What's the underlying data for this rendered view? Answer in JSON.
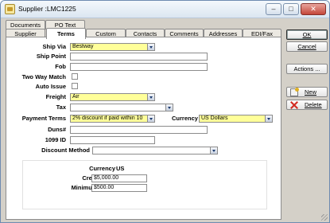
{
  "window": {
    "title": "Supplier :LMC1225",
    "minimize_icon": "minimize-icon",
    "maximize_icon": "maximize-icon",
    "close_icon": "close-icon"
  },
  "tabs_top": [
    {
      "label": "Documents"
    },
    {
      "label": "PO Text"
    }
  ],
  "tabs_main": [
    {
      "label": "Supplier"
    },
    {
      "label": "Terms",
      "active": true
    },
    {
      "label": "Custom"
    },
    {
      "label": "Contacts"
    },
    {
      "label": "Comments"
    },
    {
      "label": "Addresses"
    },
    {
      "label": "EDI/Fax"
    }
  ],
  "form": {
    "ship_via": {
      "label": "Ship Via",
      "value": "Bestway"
    },
    "ship_point": {
      "label": "Ship Point",
      "value": ""
    },
    "fob": {
      "label": "Fob",
      "value": ""
    },
    "two_way_match": {
      "label": "Two Way Match",
      "checked": false
    },
    "auto_issue": {
      "label": "Auto Issue",
      "checked": false
    },
    "freight": {
      "label": "Freight",
      "value": "Air"
    },
    "tax": {
      "label": "Tax",
      "value": ""
    },
    "payment_terms": {
      "label": "Payment Terms",
      "value": "2% discount if paid within 10"
    },
    "currency": {
      "label": "Currency",
      "value": "US Dollars"
    },
    "duns": {
      "label": "Duns#",
      "value": ""
    },
    "id_1099": {
      "label": "1099 ID",
      "value": ""
    },
    "discount_method": {
      "label": "Discount Method",
      "value": ""
    }
  },
  "credit": {
    "currency_label": "Currency",
    "currency_value": "US",
    "credit_limit": {
      "label": "Credit Limit",
      "value": "$5,000.00"
    },
    "minimum_order": {
      "label": "Minimum Order",
      "value": "$500.00"
    }
  },
  "buttons": {
    "ok": "OK",
    "cancel": "Cancel",
    "actions": "Actions ...",
    "new": "New",
    "delete": "Delete"
  },
  "colors": {
    "required_field": "#ffff99",
    "window_bg": "#d4d0c8"
  }
}
